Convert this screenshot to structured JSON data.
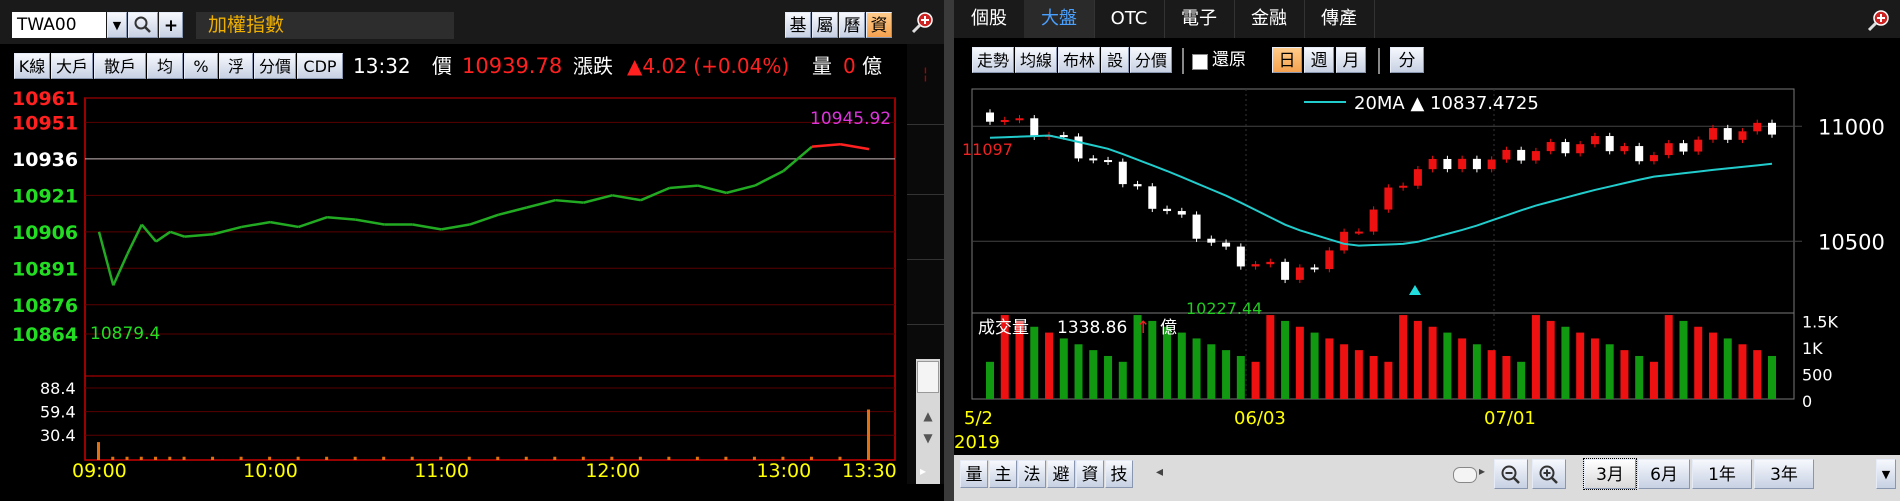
{
  "left": {
    "symbol": "TWA00",
    "index_name": "加權指數",
    "top_buttons": [
      "基",
      "屬",
      "曆",
      "資"
    ],
    "toolbar": [
      "K線",
      "大戶",
      "散戶",
      "均",
      "%",
      "浮",
      "分價",
      "CDP"
    ],
    "time": "13:32",
    "price_label": "價",
    "price": "10939.78",
    "change_label": "漲跌",
    "change": "▲4.02 (+0.04%)",
    "volume_label": "量",
    "volume_value": "0",
    "volume_unit": "億",
    "price_axis": [
      {
        "v": "10961",
        "color": "#ff2020"
      },
      {
        "v": "10951",
        "color": "#ff2020"
      },
      {
        "v": "10936",
        "color": "#ffffff"
      },
      {
        "v": "10921",
        "color": "#22dd22"
      },
      {
        "v": "10906",
        "color": "#22dd22"
      },
      {
        "v": "10891",
        "color": "#22dd22"
      },
      {
        "v": "10876",
        "color": "#22dd22"
      },
      {
        "v": "10864",
        "color": "#22dd22"
      }
    ],
    "high_label": "10945.92",
    "low_label": "10879.4",
    "vol_axis": [
      "88.4",
      "59.4",
      "30.4"
    ],
    "time_axis": [
      "09:00",
      "10:00",
      "11:00",
      "12:00",
      "13:00",
      "13:30"
    ],
    "colors": {
      "up": "#ff2020",
      "down": "#22aa22",
      "axis": "#ffff00",
      "frame": "#cc0000"
    }
  },
  "right": {
    "tabs": [
      "個股",
      "大盤",
      "OTC",
      "電子",
      "金融",
      "傳產"
    ],
    "active_tab": "大盤",
    "toolbar": [
      "走勢",
      "均線",
      "布林",
      "設",
      "分價"
    ],
    "restore_label": "還原",
    "periods": [
      "日",
      "週",
      "月"
    ],
    "active_period": "日",
    "minute_label": "分",
    "ma_legend": "20MA ▲ 10837.4725",
    "price_axis": [
      "11000",
      "10500"
    ],
    "high_label": "11097",
    "low_label": "10227.44",
    "volume_title": "成交量",
    "volume_value": "1338.86",
    "volume_arrow": "↑",
    "volume_unit": "億",
    "vol_axis": [
      "1.5K",
      "1K",
      "500",
      "0"
    ],
    "date_axis": [
      "5/2",
      "06/03",
      "07/01"
    ],
    "year": "2019",
    "bottom_left_buttons": [
      "量",
      "主",
      "法",
      "避",
      "資",
      "技"
    ],
    "range_buttons": [
      "3月",
      "6月",
      "1年",
      "3年"
    ],
    "active_range": "3月",
    "colors": {
      "up": "#ee1111",
      "down": "#ffffff",
      "ma": "#22cccc",
      "vol_up": "#ee1111",
      "vol_down": "#119911"
    }
  },
  "chart_data": [
    {
      "type": "line",
      "title": "加權指數",
      "xlabel": "",
      "ylabel": "",
      "x": [
        "09:00",
        "09:05",
        "09:10",
        "09:15",
        "09:20",
        "09:25",
        "09:30",
        "09:40",
        "09:50",
        "10:00",
        "10:10",
        "10:20",
        "10:30",
        "10:40",
        "10:50",
        "11:00",
        "11:10",
        "11:20",
        "11:30",
        "11:40",
        "11:50",
        "12:00",
        "12:10",
        "12:20",
        "12:30",
        "12:40",
        "12:50",
        "13:00",
        "13:10",
        "13:20",
        "13:30"
      ],
      "series": [
        {
          "values": [
            10906,
            10884,
            10897,
            10909,
            10902,
            10906,
            10904,
            10905,
            10908,
            10910,
            10908,
            10912,
            10911,
            10909,
            10909,
            10907,
            10909,
            10913,
            10916,
            10919,
            10918,
            10921,
            10919,
            10924,
            10925,
            10922,
            10925,
            10931,
            10941,
            10942,
            10940
          ]
        }
      ],
      "ylim": [
        10864,
        10961
      ],
      "volume_ylim": [
        0,
        88.4
      ]
    },
    {
      "type": "line",
      "title": "",
      "x": [
        "5/2",
        "5/9",
        "5/16",
        "5/23",
        "5/30",
        "06/03",
        "06/10",
        "06/17",
        "06/24",
        "07/01",
        "07/08",
        "07/15",
        "07/22",
        "07/29"
      ],
      "series": [
        {
          "values": [
            11060,
            10960,
            10800,
            10630,
            10430,
            10340,
            10540,
            10800,
            10850,
            10890,
            10920,
            10880,
            10960,
            10980
          ]
        },
        {
          "name": "20MA",
          "values": [
            10950,
            10960,
            10900,
            10800,
            10690,
            10560,
            10480,
            10490,
            10560,
            10650,
            10720,
            10780,
            10810,
            10837
          ]
        }
      ],
      "ylim": [
        10227.44,
        11097
      ],
      "volume_ylim": [
        0,
        1600
      ]
    }
  ]
}
